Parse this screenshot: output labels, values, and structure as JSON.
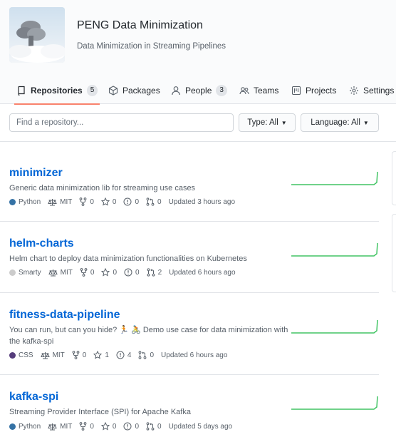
{
  "org": {
    "name": "PENG Data Minimization",
    "description": "Data Minimization in Streaming Pipelines",
    "avatar": "organization-avatar"
  },
  "tabs": [
    {
      "label": "Repositories",
      "count": "5",
      "icon": "repo-icon",
      "selected": true
    },
    {
      "label": "Packages",
      "icon": "package-icon"
    },
    {
      "label": "People",
      "count": "3",
      "icon": "person-icon"
    },
    {
      "label": "Teams",
      "icon": "people-icon"
    },
    {
      "label": "Projects",
      "icon": "project-icon"
    },
    {
      "label": "Settings",
      "icon": "gear-icon"
    }
  ],
  "toolbar": {
    "search_placeholder": "Find a repository...",
    "type_label": "Type: All",
    "language_label": "Language: All"
  },
  "colors": {
    "accent_link": "#0366d6",
    "selected_tab_underline": "#f9826c",
    "sparkline": "#40c463",
    "lang_python": "#3572A5",
    "lang_smarty": "#cccccc",
    "lang_css": "#563d7c"
  },
  "repos": [
    {
      "name": "minimizer",
      "description": "Generic data minimization lib for streaming use cases",
      "language": "Python",
      "language_color": "#3572A5",
      "license": "MIT",
      "forks": "0",
      "stars": "0",
      "issues": "0",
      "prs": "0",
      "updated": "Updated 3 hours ago"
    },
    {
      "name": "helm-charts",
      "description": "Helm chart to deploy data minimization functionalities on Kubernetes",
      "language": "Smarty",
      "language_color": "#cccccc",
      "license": "MIT",
      "forks": "0",
      "stars": "0",
      "issues": "0",
      "prs": "2",
      "updated": "Updated 6 hours ago"
    },
    {
      "name": "fitness-data-pipeline",
      "description": "You can run, but can you hide? 🏃 🚴 Demo use case for data minimization with the kafka-spi",
      "language": "CSS",
      "language_color": "#563d7c",
      "license": "MIT",
      "forks": "0",
      "stars": "1",
      "issues": "4",
      "prs": "0",
      "updated": "Updated 6 hours ago"
    },
    {
      "name": "kafka-spi",
      "description": "Streaming Provider Interface (SPI) for Apache Kafka",
      "language": "Python",
      "language_color": "#3572A5",
      "license": "MIT",
      "forks": "0",
      "stars": "0",
      "issues": "0",
      "prs": "0",
      "updated": "Updated 5 days ago"
    }
  ]
}
